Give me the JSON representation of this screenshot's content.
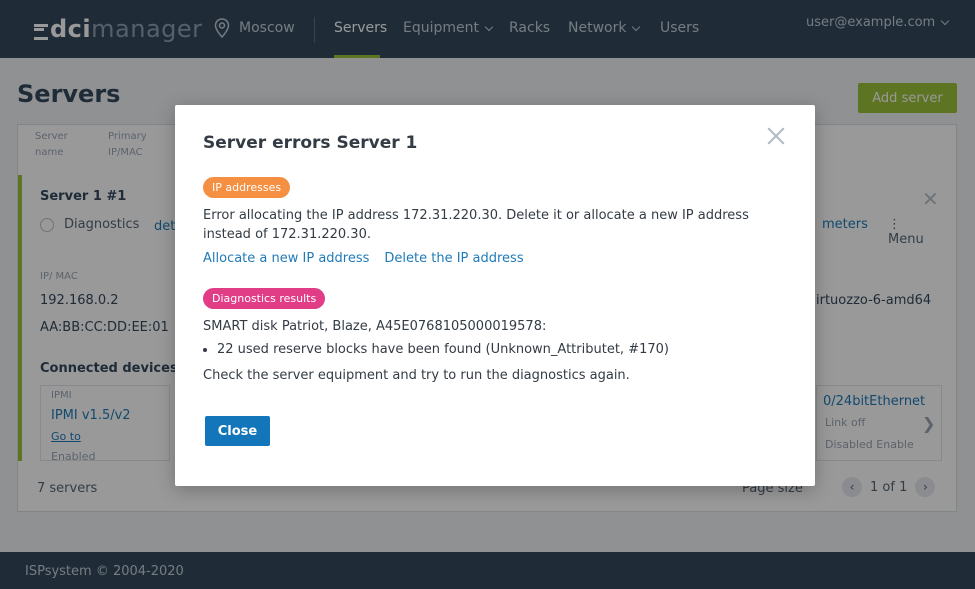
{
  "app": {
    "logo_part1": "dci",
    "logo_part2": "manager",
    "location": "Moscow",
    "nav": [
      {
        "label": "Servers",
        "active": true
      },
      {
        "label": "Equipment",
        "dropdown": true
      },
      {
        "label": "Racks"
      },
      {
        "label": "Network",
        "dropdown": true
      },
      {
        "label": "Users"
      }
    ],
    "user_email": "user@example.com",
    "accent_color": "#9cc23a",
    "brand_color": "#344a5e"
  },
  "page": {
    "title": "Servers",
    "add_button": "Add server",
    "columns": [
      "Server name",
      "Primary IP/MAC"
    ],
    "card": {
      "title": "Server 1 #1",
      "diagnostics_label": "Diagnostics",
      "link_fragment": "det",
      "params_fragment": "meters",
      "menu_label": "Menu",
      "ip_label": "IP/ MAC",
      "ip": "192.168.0.2",
      "mac": "AA:BB:CC:DD:EE:01",
      "os_fragment": "irtuozzo-6-amd64",
      "connected_title": "Connected devices",
      "ipmi": {
        "label": "IPMI",
        "name": "IPMI v1.5/v2",
        "goto": "Go to",
        "state": "Enabled"
      },
      "port": {
        "name": "0/24bitEthernet",
        "status": "Link off",
        "bottom": "Disabled   Enable"
      }
    },
    "footer": {
      "count": "7 servers",
      "page_size": "Page size",
      "pager": "1 of 1"
    },
    "copyright": "ISPsystem © 2004-2020"
  },
  "modal": {
    "title": "Server errors Server 1",
    "ip_badge": "IP addresses",
    "ip_badge_color": "#f58f42",
    "ip_message": "Error allocating the IP address 172.31.220.30. Delete it or allocate a new IP address instead of 172.31.220.30.",
    "ip_actions": [
      "Allocate a new IP address",
      "Delete the IP address"
    ],
    "diag_badge": "Diagnostics results",
    "diag_badge_color": "#e13d87",
    "disk_line": "SMART disk Patriot, Blaze, A45E0768105000019578:",
    "disk_items": [
      "22 used reserve blocks have been found (Unknown_Attributet, #170)"
    ],
    "check_message": "Check the server equipment and try to run the diagnostics again.",
    "close_label": "Close"
  }
}
